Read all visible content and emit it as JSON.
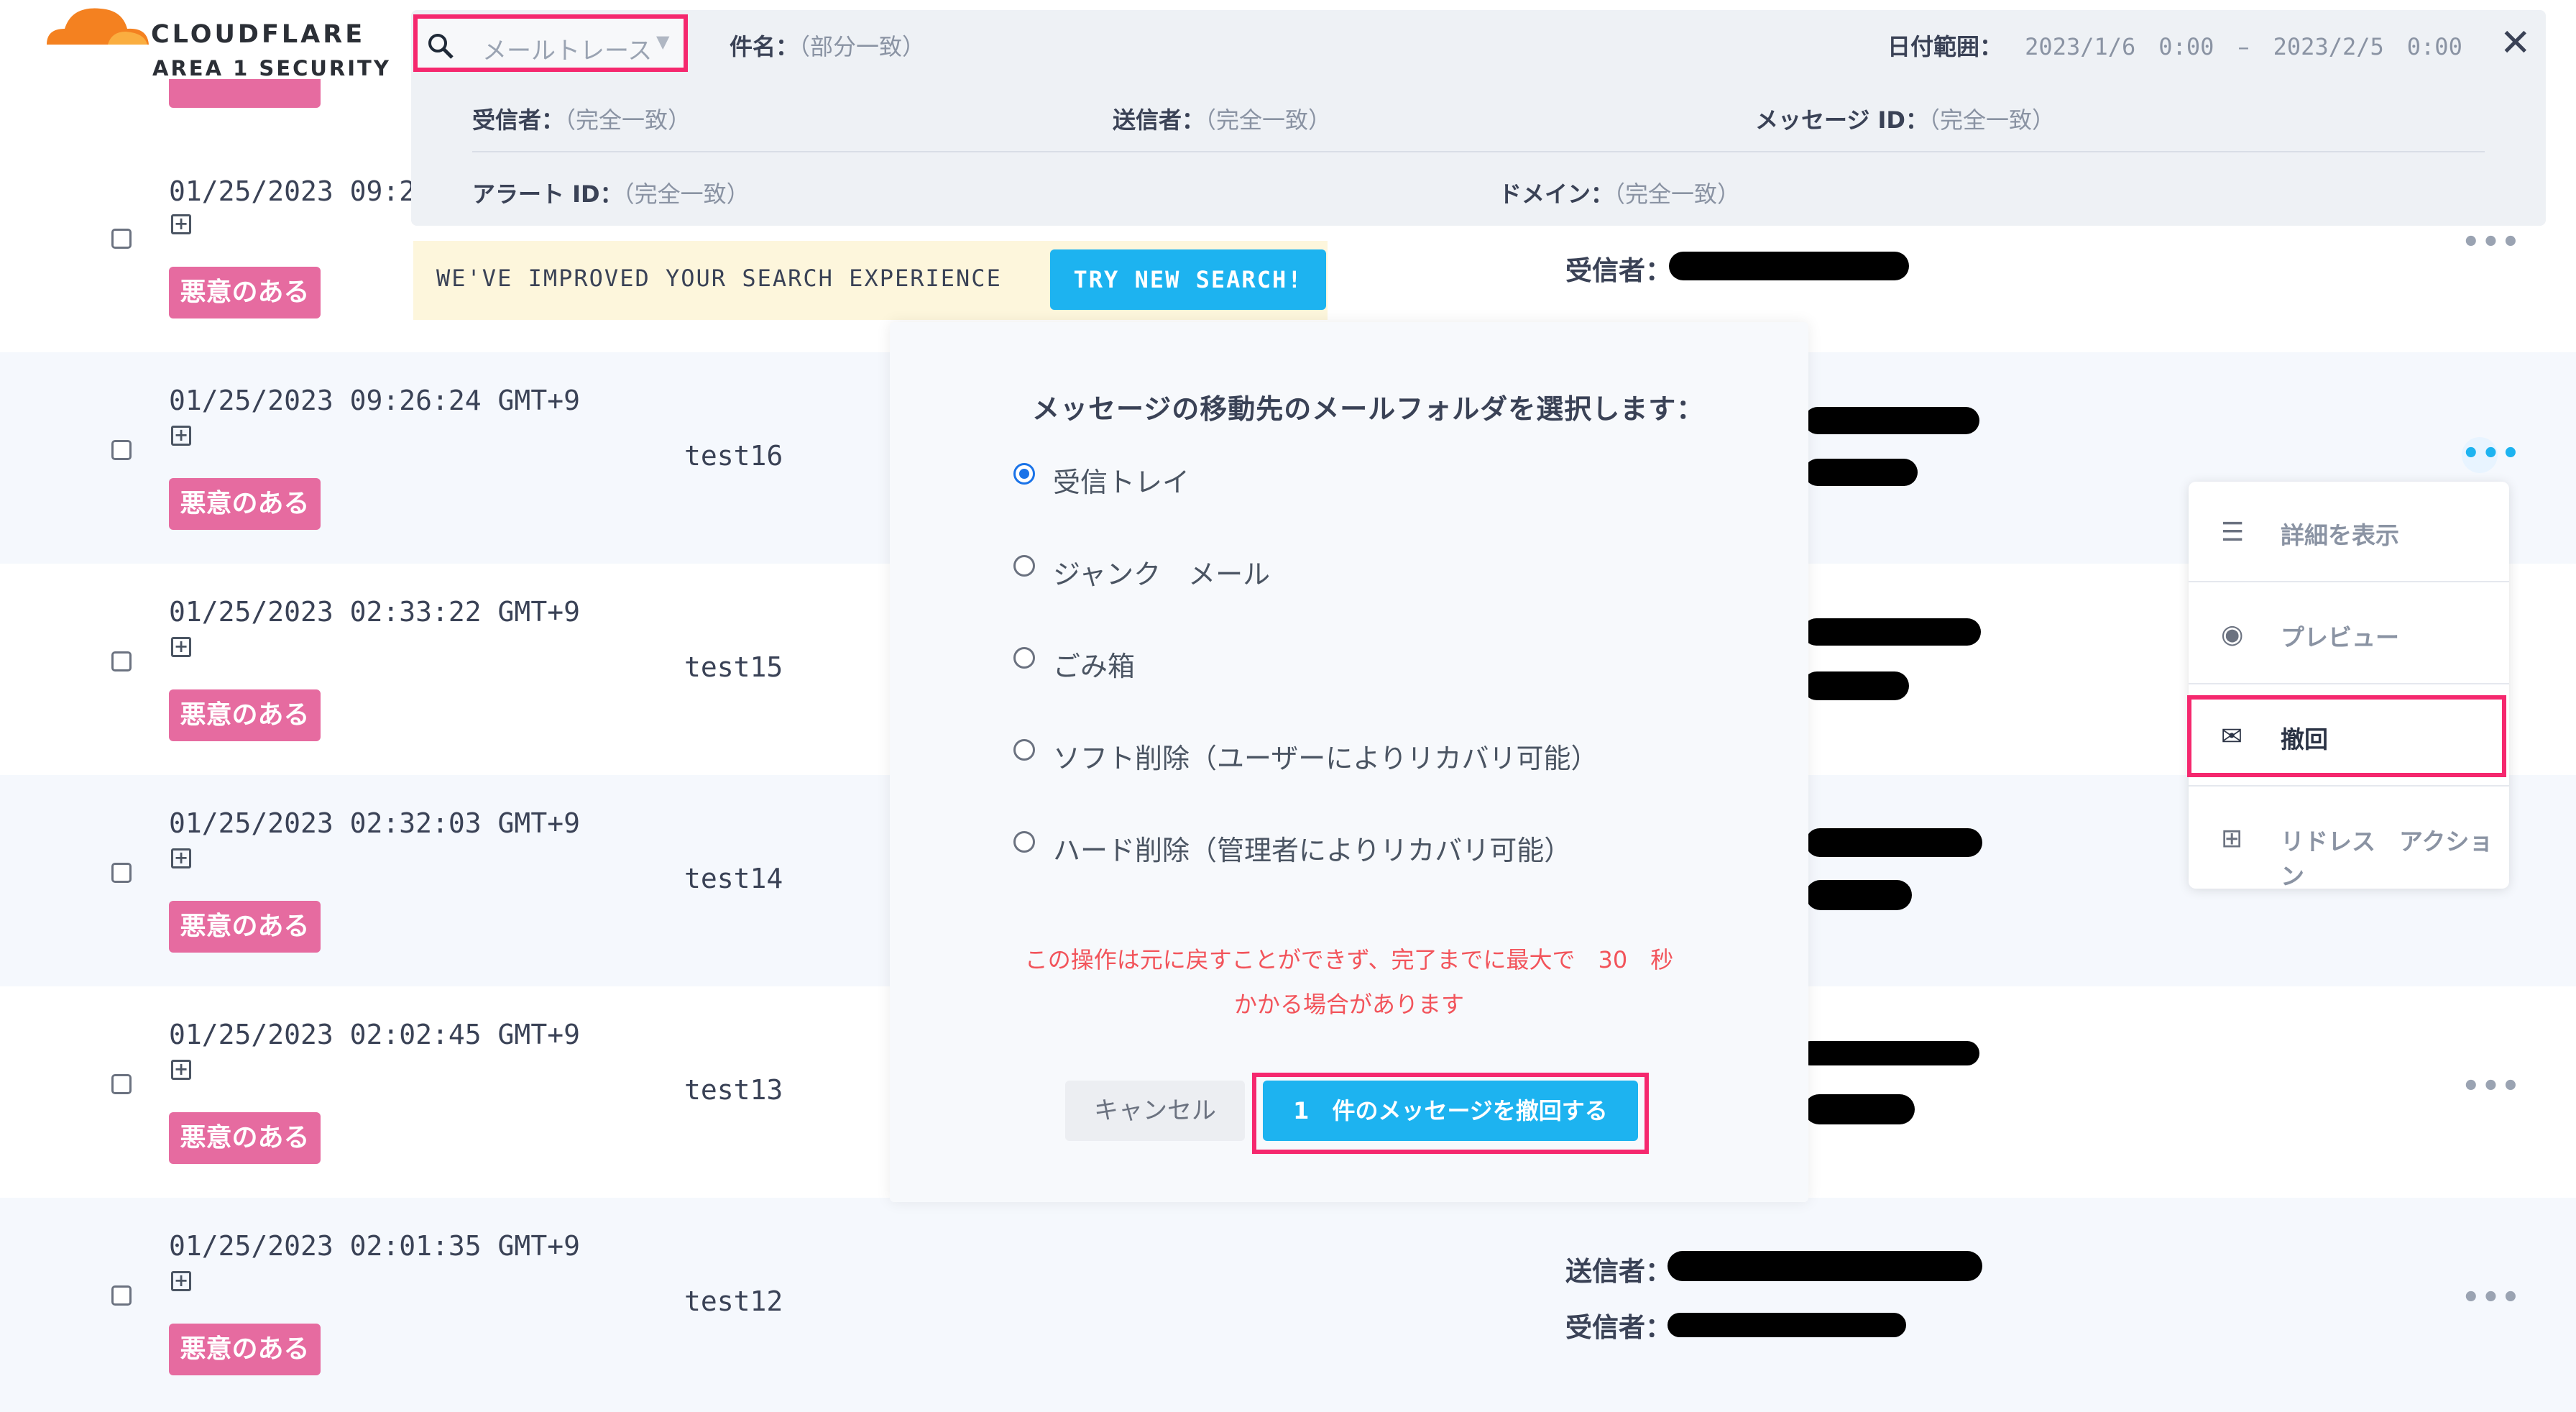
{
  "brand": {
    "name": "CLOUDFLARE",
    "product": "AREA 1 SECURITY",
    "logo_color": "#f48120"
  },
  "search": {
    "type_select": "メールトレース",
    "subject_label": "件名：",
    "subject_hint": "（部分一致）",
    "date_label": "日付範囲：",
    "date_from": "2023/1/6　0:00",
    "date_sep": "–",
    "date_to": "2023/2/5　0:00",
    "recipient_label": "受信者：",
    "recipient_hint": "（完全一致）",
    "sender_label": "送信者：",
    "sender_hint": "（完全一致）",
    "message_id_label": "メッセージ ID：",
    "message_id_hint": "（完全一致）",
    "alert_id_label": "アラート ID：",
    "alert_id_hint": "（完全一致）",
    "domain_label": "ドメイン：",
    "domain_hint": "（完全一致）"
  },
  "banner": {
    "text": "WE'VE IMPROVED YOUR SEARCH EXPERIENCE",
    "button": "TRY NEW SEARCH!"
  },
  "rows": [
    {
      "timestamp": "01/25/2023 09:2",
      "badge": "悪意のある",
      "subject": "",
      "recipient_label": "受信者："
    },
    {
      "timestamp": "01/25/2023 09:26:24 GMT+9",
      "badge": "悪意のある",
      "subject": "test16"
    },
    {
      "timestamp": "01/25/2023 02:33:22 GMT+9",
      "badge": "悪意のある",
      "subject": "test15"
    },
    {
      "timestamp": "01/25/2023 02:32:03 GMT+9",
      "badge": "悪意のある",
      "subject": "test14"
    },
    {
      "timestamp": "01/25/2023 02:02:45 GMT+9",
      "badge": "悪意のある",
      "subject": "test13"
    },
    {
      "timestamp": "01/25/2023 02:01:35 GMT+9",
      "badge": "悪意のある",
      "subject": "test12",
      "sender_label": "送信者：",
      "recipient_label": "受信者："
    }
  ],
  "modal": {
    "title": "メッセージの移動先のメールフォルダを選択します：",
    "options": [
      "受信トレイ",
      "ジャンク　メール",
      "ごみ箱",
      "ソフト削除（ユーザーによりリカバリ可能）",
      "ハード削除（管理者によりリカバリ可能）"
    ],
    "selected_index": 0,
    "warning_line1": "この操作は元に戻すことができず、完了までに最大で　30　秒",
    "warning_line2": "かかる場合があります",
    "cancel": "キャンセル",
    "confirm": "1　件のメッセージを撤回する"
  },
  "menu": {
    "items": [
      {
        "label": "詳細を表示",
        "icon": "list-icon"
      },
      {
        "label": "プレビュー",
        "icon": "eye-icon"
      },
      {
        "label": "撤回",
        "icon": "recall-icon"
      },
      {
        "label": "リドレス　アクション",
        "icon": "plus-square-icon"
      }
    ]
  },
  "colors": {
    "accent": "#1db3f0",
    "badge": "#e66ba0",
    "highlight": "#f5286e",
    "warning": "#f2545b"
  }
}
